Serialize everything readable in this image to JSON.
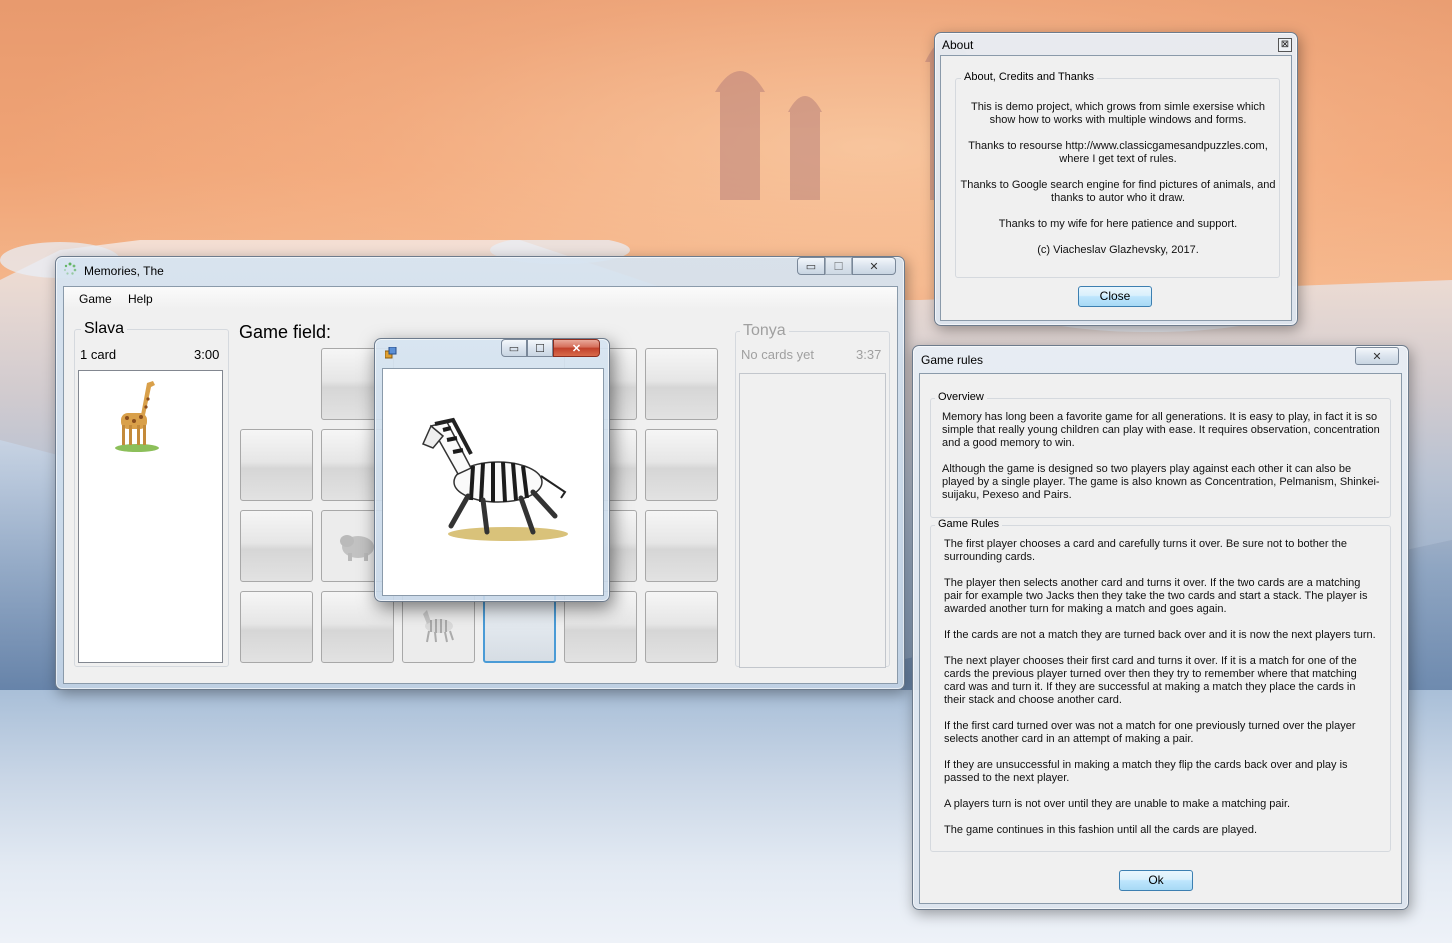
{
  "main_window": {
    "title": "Memories, The",
    "menu": [
      "Game",
      "Help"
    ],
    "game_field_label": "Game field:",
    "player1": {
      "name": "Slava",
      "cards": "1 card",
      "time": "3:00"
    },
    "player2": {
      "name": "Tonya",
      "cards": "No cards yet",
      "time": "3:37"
    },
    "caption_buttons": {
      "minimize": "▭",
      "maximize": "☐",
      "close": "✕"
    }
  },
  "popup_window": {
    "title": "",
    "image": "zebra",
    "caption_buttons": {
      "minimize": "▭",
      "maximize": "☐",
      "close": "✕"
    }
  },
  "about_window": {
    "title": "About",
    "close_glyph": "⊠",
    "group_title": "About, Credits and Thanks",
    "paragraphs": [
      "This is demo project, which grows from simle exersise which show how to works with multiple windows and forms.",
      "Thanks to resourse http://www.classicgamesandpuzzles.com, where I get text of rules.",
      "Thanks to Google search engine for find pictures of animals, and thanks to autor who it draw.",
      "Thanks to my wife for here patience and support.",
      "(c) Viacheslav Glazhevsky, 2017."
    ],
    "close_button": "Close"
  },
  "rules_window": {
    "title": "Game rules",
    "close_glyph": "✕",
    "overview_title": "Overview",
    "overview": [
      "Memory has long been a favorite game for all generations. It is easy to play, in fact it is so simple that really young children can play with ease. It requires observation, concentration and a good memory to win.",
      "Although the game is designed so two players play against each other it can also be played by a single player. The game is also known as Concentration, Pelmanism, Shinkei-suijaku, Pexeso and Pairs."
    ],
    "rules_title": "Game Rules",
    "rules": [
      "The first player chooses a card and carefully turns it over. Be sure not to bother the surrounding cards.",
      "The player then selects another card and turns it over. If the two cards are a matching pair for example two Jacks then they take the two cards and start a stack. The player is awarded another turn for making a match and goes again.",
      "If the cards are not a match they are turned back over and it is now the next players turn.",
      "The next player chooses their first card and turns it over. If it is a match for one of the cards the previous player turned over then they try to remember where that matching card was and turn it. If they are successful at making a match they place the cards in their stack and choose another card.",
      "If the first card turned over was not a match for one previously turned over the player selects another card in an attempt of making a pair.",
      "If they are unsuccessful in making a match they flip the cards back over and play is passed to the next player.",
      "A players turn is not over until they are unable to make a matching pair.",
      "The game continues in this fashion until all the cards are played."
    ],
    "ok_button": "Ok"
  }
}
